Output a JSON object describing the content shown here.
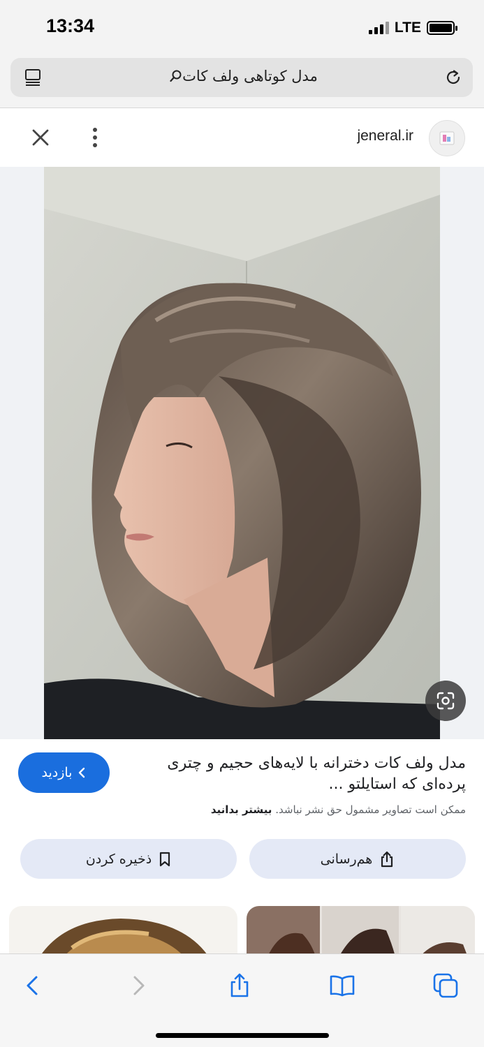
{
  "status_bar": {
    "time": "13:34",
    "network": "LTE"
  },
  "search": {
    "query": "مدل کوتاهی ولف کات"
  },
  "site": {
    "domain": "jeneral.ir"
  },
  "result": {
    "visit_label": "بازدید",
    "title": "مدل ولف کات دخترانه با لایه‌های حجیم و چتری پرده‌ای که استایلتو ...",
    "copyright_text": "ممکن است تصاویر مشمول حق نشر نباشد.",
    "learn_more": "بیشتر بدانید",
    "save_label": "ذخیره کردن",
    "share_label": "هم‌رسانی"
  },
  "icons": {
    "tabs": "tabs-icon",
    "reload": "reload-icon",
    "search": "search-icon",
    "close": "close-icon",
    "more": "more-vertical-icon",
    "lens": "lens-icon",
    "back": "back-icon",
    "forward": "forward-icon",
    "share": "share-icon",
    "bookmarks": "bookmarks-icon",
    "tab_switcher": "tab-switcher-icon"
  },
  "colors": {
    "accent": "#1a6ede",
    "pill": "#e4e9f6",
    "toolbar_icon": "#1a73e8"
  }
}
